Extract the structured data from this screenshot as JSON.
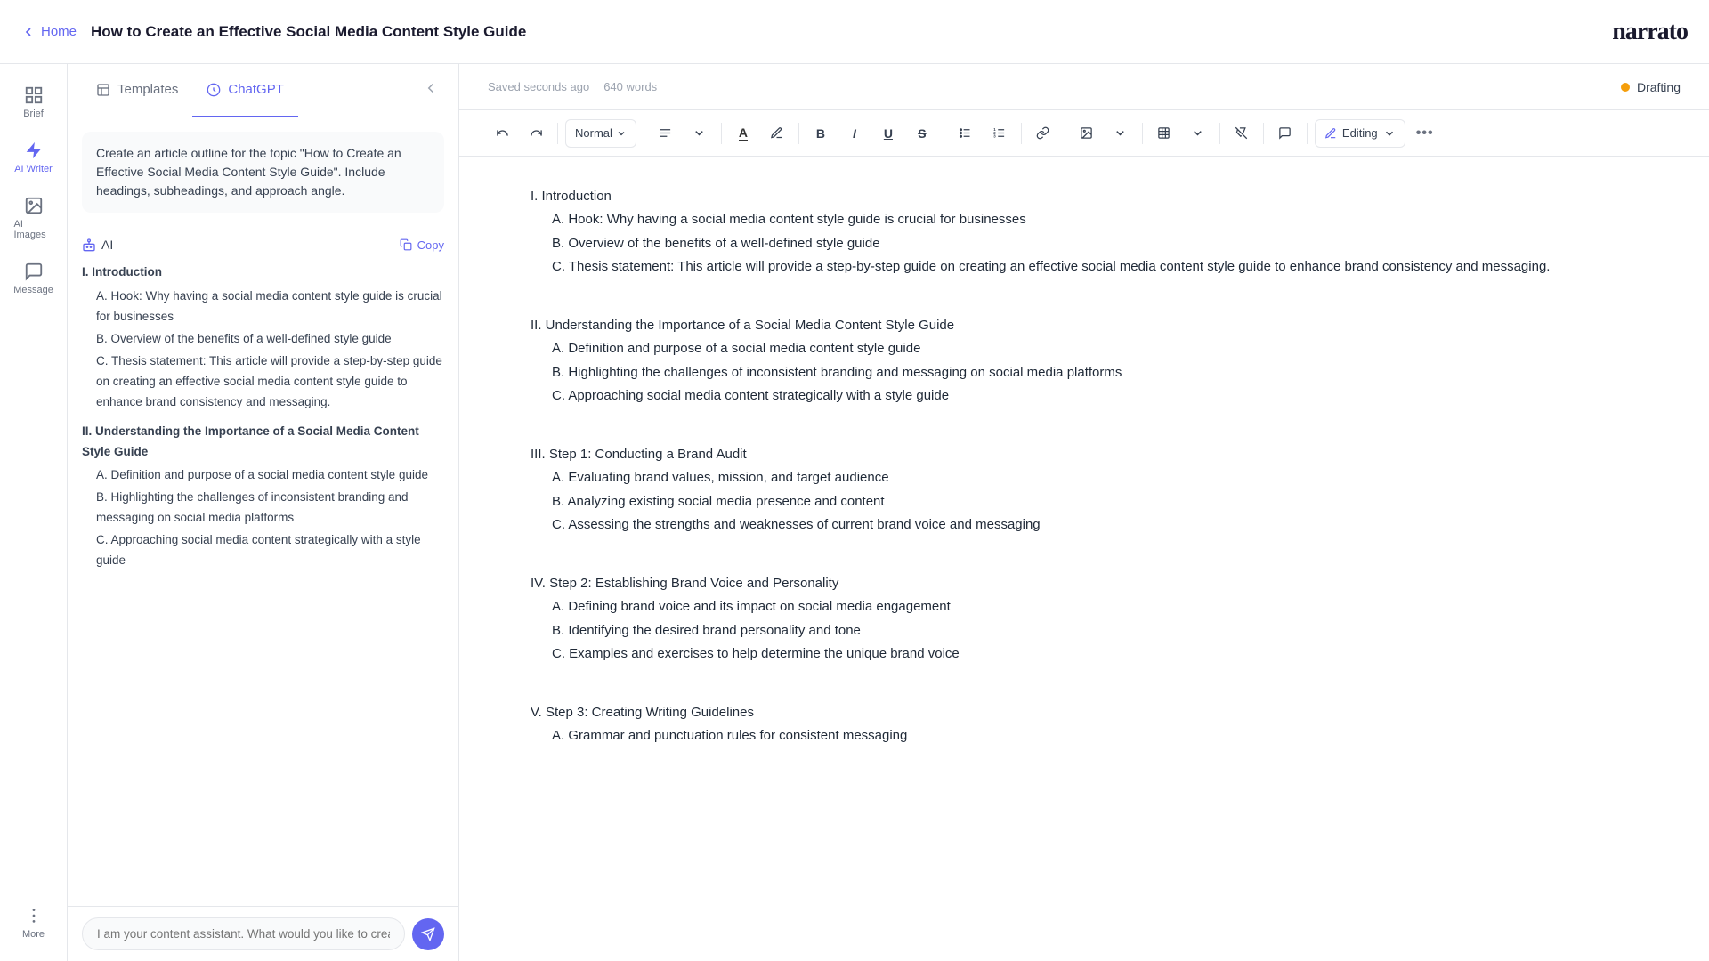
{
  "topbar": {
    "home_label": "Home",
    "doc_title": "How to Create an Effective Social Media Content Style Guide",
    "logo": "narrato"
  },
  "sidebar": {
    "items": [
      {
        "id": "brief",
        "label": "Brief",
        "icon": "grid-icon"
      },
      {
        "id": "ai-writer",
        "label": "AI Writer",
        "icon": "lightning-icon"
      },
      {
        "id": "ai-images",
        "label": "AI Images",
        "icon": "image-icon"
      },
      {
        "id": "message",
        "label": "Message",
        "icon": "message-icon"
      },
      {
        "id": "more",
        "label": "More",
        "icon": "more-icon"
      }
    ]
  },
  "panel": {
    "tabs": [
      {
        "id": "templates",
        "label": "Templates"
      },
      {
        "id": "chatgpt",
        "label": "ChatGPT"
      }
    ],
    "active_tab": "chatgpt",
    "prompt_text": "Create an article outline for the topic \"How to Create an Effective Social Media Content Style Guide\". Include headings, subheadings, and approach angle.",
    "ai_label": "AI",
    "copy_label": "Copy",
    "outline": [
      {
        "text": "I. Introduction",
        "level": 0
      },
      {
        "text": "A. Hook: Why having a social media content style guide is crucial for businesses",
        "level": 1
      },
      {
        "text": "B. Overview of the benefits of a well-defined style guide",
        "level": 1
      },
      {
        "text": "C. Thesis statement: This article will provide a step-by-step guide on creating an effective social media content style guide to enhance brand consistency and messaging.",
        "level": 1
      },
      {
        "text": "II. Understanding the Importance of a Social Media Content Style Guide",
        "level": 0
      },
      {
        "text": "A. Definition and purpose of a social media content style guide",
        "level": 1
      },
      {
        "text": "B. Highlighting the challenges of inconsistent branding and messaging on social media platforms",
        "level": 1
      },
      {
        "text": "C. Approaching social media content strategically with a style guide",
        "level": 1
      }
    ],
    "chat_placeholder": "I am your content assistant. What would you like to create or find out today?"
  },
  "editor": {
    "saved_text": "Saved seconds ago",
    "word_count": "640 words",
    "status": "Drafting",
    "toolbar": {
      "undo_label": "↩",
      "redo_label": "↪",
      "style_label": "Normal",
      "align_label": "≡",
      "text_color_label": "A",
      "highlight_label": "✏",
      "bold_label": "B",
      "italic_label": "I",
      "underline_label": "U",
      "strike_label": "S",
      "bullet_label": "≡",
      "number_label": "#",
      "link_label": "🔗",
      "image_label": "🖼",
      "table_label": "⊞",
      "format_label": "⊗",
      "comment_label": "💬",
      "editing_label": "Editing",
      "more_label": "..."
    },
    "content": [
      {
        "text": "I. Introduction",
        "level": 0
      },
      {
        "text": "A. Hook: Why having a social media content style guide is crucial for businesses",
        "level": 1
      },
      {
        "text": "B. Overview of the benefits of a well-defined style guide",
        "level": 1
      },
      {
        "text": "C. Thesis statement: This article will provide a step-by-step guide on creating an effective social media content style guide to enhance brand consistency and messaging.",
        "level": 1
      },
      {
        "text": "",
        "level": -1
      },
      {
        "text": "II. Understanding the Importance of a Social Media Content Style Guide",
        "level": 0
      },
      {
        "text": "A. Definition and purpose of a social media content style guide",
        "level": 1
      },
      {
        "text": "B. Highlighting the challenges of inconsistent branding and messaging on social media platforms",
        "level": 1
      },
      {
        "text": "C. Approaching social media content strategically with a style guide",
        "level": 1
      },
      {
        "text": "",
        "level": -1
      },
      {
        "text": "III. Step 1: Conducting a Brand Audit",
        "level": 0
      },
      {
        "text": "A. Evaluating brand values, mission, and target audience",
        "level": 1
      },
      {
        "text": "B. Analyzing existing social media presence and content",
        "level": 1
      },
      {
        "text": "C. Assessing the strengths and weaknesses of current brand voice and messaging",
        "level": 1
      },
      {
        "text": "",
        "level": -1
      },
      {
        "text": "IV. Step 2: Establishing Brand Voice and Personality",
        "level": 0
      },
      {
        "text": "A. Defining brand voice and its impact on social media engagement",
        "level": 1
      },
      {
        "text": "B. Identifying the desired brand personality and tone",
        "level": 1
      },
      {
        "text": "C. Examples and exercises to help determine the unique brand voice",
        "level": 1
      },
      {
        "text": "",
        "level": -1
      },
      {
        "text": "V. Step 3: Creating Writing Guidelines",
        "level": 0
      },
      {
        "text": "A. Grammar and punctuation rules for consistent messaging",
        "level": 1
      }
    ]
  }
}
